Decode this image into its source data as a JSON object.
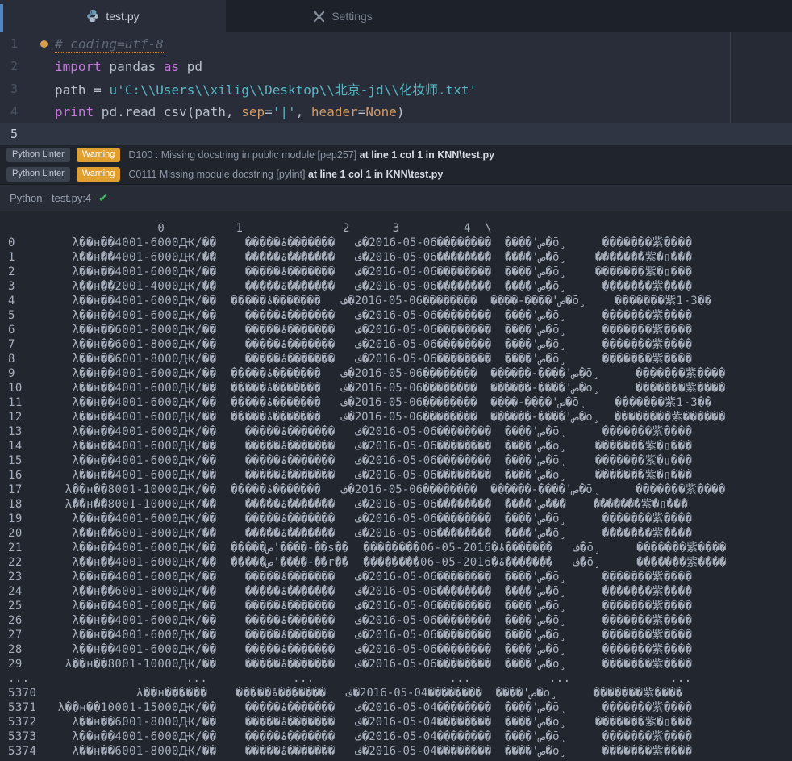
{
  "tabbar": {
    "tabs": [
      {
        "label": "test.py",
        "icon": "python"
      },
      {
        "label": "Settings",
        "icon": "tools"
      }
    ]
  },
  "editor": {
    "lines": [
      {
        "num": "1",
        "dot": true,
        "tokens": [
          {
            "cls": "comment ul",
            "t": "# coding=utf-8"
          }
        ]
      },
      {
        "num": "2",
        "tokens": [
          {
            "cls": "kw",
            "t": "import"
          },
          {
            "cls": "fg",
            "t": " pandas "
          },
          {
            "cls": "kw",
            "t": "as"
          },
          {
            "cls": "fg",
            "t": " pd"
          }
        ]
      },
      {
        "num": "3",
        "tokens": [
          {
            "cls": "fg",
            "t": "path = "
          },
          {
            "cls": "str",
            "t": "u'C:\\\\Users\\\\xilig\\\\Desktop\\\\北京-jd\\\\化妆师.txt'"
          }
        ]
      },
      {
        "num": "4",
        "tokens": [
          {
            "cls": "kw",
            "t": "print"
          },
          {
            "cls": "fg",
            "t": " pd.read_csv(path, "
          },
          {
            "cls": "orange",
            "t": "sep"
          },
          {
            "cls": "fg",
            "t": "="
          },
          {
            "cls": "str",
            "t": "'|'"
          },
          {
            "cls": "fg",
            "t": ", "
          },
          {
            "cls": "orange",
            "t": "header"
          },
          {
            "cls": "fg",
            "t": "="
          },
          {
            "cls": "orange",
            "t": "None"
          },
          {
            "cls": "fg",
            "t": ")"
          }
        ]
      },
      {
        "num": "5",
        "current": true,
        "tokens": []
      }
    ]
  },
  "lint": {
    "warnings": [
      {
        "source": "Python Linter",
        "level": "Warning",
        "message": "D100 : Missing docstring in public module [pep257] ",
        "location": "at line 1 col 1 in KNN\\test.py"
      },
      {
        "source": "Python Linter",
        "level": "Warning",
        "message": "C0111 Missing module docstring [pylint] ",
        "location": "at line 1 col 1 in KNN\\test.py"
      }
    ]
  },
  "status": {
    "label": "Python - test.py:4",
    "check": "✔"
  },
  "output": {
    "header_line": "                     0          1              2      3         4  \\",
    "col_widths": {
      "i": 5,
      "c0": 23,
      "c1": 13,
      "c2": 20,
      "c3": 12,
      "c4": 15
    },
    "rows": [
      {
        "i": "0",
        "c0": "λ��н��4001-6000Ԫ/��",
        "c1": "�����ص'����",
        "c2": "��������06-05-2016�ف",
        "c3": "�������ۂ�ō¸",
        "c4": "�������紫����"
      },
      {
        "i": "1",
        "c0": "λ��н��4001-6000Ԫ/��",
        "c1": "�����ص'����",
        "c2": "��������06-05-2016�ف",
        "c3": "�������ۂ�ō¸",
        "c4": "�������紫�▯���"
      },
      {
        "i": "2",
        "c0": "λ��н��4001-6000Ԫ/��",
        "c1": "�����ص'����",
        "c2": "��������06-05-2016�ف",
        "c3": "�������ۂ�ō¸",
        "c4": "�������紫�▯���"
      },
      {
        "i": "3",
        "c0": "λ��н��2001-4000Ԫ/��",
        "c1": "�����ص'����",
        "c2": "��������06-05-2016�ف",
        "c3": "�������ۂ�ō¸",
        "c4": "�������紫����"
      },
      {
        "i": "4",
        "c0": "λ��н��4001-6000Ԫ/��",
        "c1": "�����ص'����-����",
        "c2": "��������06-05-2016�ف",
        "c3": "�������ۂ�ō¸",
        "c4": "�������紫1-3��"
      },
      {
        "i": "5",
        "c0": "λ��н��4001-6000Ԫ/��",
        "c1": "�����ص'����",
        "c2": "��������06-05-2016�ف",
        "c3": "�������ۂ�ō¸",
        "c4": "�������紫����"
      },
      {
        "i": "6",
        "c0": "λ��н��6001-8000Ԫ/��",
        "c1": "�����ص'����",
        "c2": "��������06-05-2016�ف",
        "c3": "�������ۂ�ō¸",
        "c4": "�������紫����"
      },
      {
        "i": "7",
        "c0": "λ��н��6001-8000Ԫ/��",
        "c1": "�����ص'����",
        "c2": "��������06-05-2016�ف",
        "c3": "�������ۂ�ō¸",
        "c4": "�������紫����"
      },
      {
        "i": "8",
        "c0": "λ��н��6001-8000Ԫ/��",
        "c1": "�����ص'����",
        "c2": "��������06-05-2016�ف",
        "c3": "�������ۂ�ō¸",
        "c4": "�������紫����"
      },
      {
        "i": "9",
        "c0": "λ��н��4001-6000Ԫ/��",
        "c1": "�����ص'����-������",
        "c2": "��������06-05-2016�ف",
        "c3": "�������ۂ�ō¸",
        "c4": "�������紫����"
      },
      {
        "i": "10",
        "c0": "λ��н��4001-6000Ԫ/��",
        "c1": "�����ص'����-������",
        "c2": "��������06-05-2016�ف",
        "c3": "�������ۂ�ō¸",
        "c4": "�������紫����"
      },
      {
        "i": "11",
        "c0": "λ��н��4001-6000Ԫ/��",
        "c1": "�����ص'����-����",
        "c2": "��������06-05-2016�ف",
        "c3": "�������ۂ�ō¸",
        "c4": "�������紫1-3��"
      },
      {
        "i": "12",
        "c0": "λ��н��4001-6000Ԫ/��",
        "c1": "�����ص'����-������",
        "c2": "��������06-05-2016�ف",
        "c3": "�������ۂ�ō¸",
        "c4": "��������紫������"
      },
      {
        "i": "13",
        "c0": "λ��н��4001-6000Ԫ/��",
        "c1": "�����ص'����",
        "c2": "��������06-05-2016�ف",
        "c3": "�������ۂ�ō¸",
        "c4": "�������紫����"
      },
      {
        "i": "14",
        "c0": "λ��н��4001-6000Ԫ/��",
        "c1": "�����ص'����",
        "c2": "��������06-05-2016�ف",
        "c3": "�������ۂ�ō¸",
        "c4": "�������紫�▯���"
      },
      {
        "i": "15",
        "c0": "λ��н��4001-6000Ԫ/��",
        "c1": "�����ص'����",
        "c2": "��������06-05-2016�ف",
        "c3": "�������ۂ�ō¸",
        "c4": "�������紫�▯���"
      },
      {
        "i": "16",
        "c0": "λ��н��4001-6000Ԫ/��",
        "c1": "�����ص'����",
        "c2": "��������06-05-2016�ف",
        "c3": "�������ۂ�ō¸",
        "c4": "�������紫�▯���"
      },
      {
        "i": "17",
        "c0": "λ��н��8001-10000Ԫ/��",
        "c1": "�����ص'����-������",
        "c2": "��������06-05-2016�ف",
        "c3": "�������ۂ�ō¸",
        "c4": "�������紫����"
      },
      {
        "i": "18",
        "c0": "λ��н��8001-10000Ԫ/��",
        "c1": "�����ص'����",
        "c2": "��������06-05-2016�ف",
        "c3": "�������ۂ���",
        "c4": "�������紫�▯���"
      },
      {
        "i": "19",
        "c0": "λ��н��4001-6000Ԫ/��",
        "c1": "�����ص'����",
        "c2": "��������06-05-2016�ف",
        "c3": "�������ۂ�ō¸",
        "c4": "�������紫����"
      },
      {
        "i": "20",
        "c0": "λ��н��6001-8000Ԫ/��",
        "c1": "�����ص'����",
        "c2": "��������06-05-2016�ف",
        "c3": "�������ۂ�ō¸",
        "c4": "�������紫����"
      },
      {
        "i": "21",
        "c0": "λ��н��4001-6000Ԫ/��",
        "c1": "�����ص'����-��s��",
        "c2": "��������06-05-2016�ف",
        "c3": "�������ۂ�ō¸",
        "c4": "�������紫����"
      },
      {
        "i": "22",
        "c0": "λ��н��4001-6000Ԫ/��",
        "c1": "�����ص'����-��r��",
        "c2": "��������06-05-2016�ف",
        "c3": "�������ۂ�ō¸",
        "c4": "�������紫����"
      },
      {
        "i": "23",
        "c0": "λ��н��4001-6000Ԫ/��",
        "c1": "�����ص'����",
        "c2": "��������06-05-2016�ف",
        "c3": "�������ۂ�ō¸",
        "c4": "�������紫����"
      },
      {
        "i": "24",
        "c0": "λ��н��6001-8000Ԫ/��",
        "c1": "�����ص'����",
        "c2": "��������06-05-2016�ف",
        "c3": "�������ۂ�ō¸",
        "c4": "�������紫����"
      },
      {
        "i": "25",
        "c0": "λ��н��4001-6000Ԫ/��",
        "c1": "�����ص'����",
        "c2": "��������06-05-2016�ف",
        "c3": "�������ۂ�ō¸",
        "c4": "�������紫����"
      },
      {
        "i": "26",
        "c0": "λ��н��4001-6000Ԫ/��",
        "c1": "�����ص'����",
        "c2": "��������06-05-2016�ف",
        "c3": "�������ۂ�ō¸",
        "c4": "�������紫����"
      },
      {
        "i": "27",
        "c0": "λ��н��4001-6000Ԫ/��",
        "c1": "�����ص'����",
        "c2": "��������06-05-2016�ف",
        "c3": "�������ۂ�ō¸",
        "c4": "�������紫����"
      },
      {
        "i": "28",
        "c0": "λ��н��4001-6000Ԫ/��",
        "c1": "�����ص'����",
        "c2": "��������06-05-2016�ف",
        "c3": "�������ۂ�ō¸",
        "c4": "�������紫����"
      },
      {
        "i": "29",
        "c0": "λ��н��8001-10000Ԫ/��",
        "c1": "�����ص'����",
        "c2": "��������06-05-2016�ف",
        "c3": "�������ۂ�ō¸",
        "c4": "�������紫����"
      },
      {
        "i": "...",
        "c0": "...",
        "c1": "...",
        "c2": "...",
        "c3": "...",
        "c4": "..."
      },
      {
        "i": "5370",
        "c0": "λ��н������",
        "c1": "�����ص'����",
        "c2": "��������04-05-2016�ف",
        "c3": "�������ۂ�ō¸",
        "c4": "�������紫����"
      },
      {
        "i": "5371",
        "c0": "λ��н��10001-15000Ԫ/��",
        "c1": "�����ص'����",
        "c2": "��������04-05-2016�ف",
        "c3": "�������ۂ�ō¸",
        "c4": "�������紫����"
      },
      {
        "i": "5372",
        "c0": "λ��н��6001-8000Ԫ/��",
        "c1": "�����ص'����",
        "c2": "��������04-05-2016�ف",
        "c3": "�������ۂ�ō¸",
        "c4": "�������紫�▯���"
      },
      {
        "i": "5373",
        "c0": "λ��н��4001-6000Ԫ/��",
        "c1": "�����ص'����",
        "c2": "��������04-05-2016�ف",
        "c3": "�������ۂ�ō¸",
        "c4": "�������紫����"
      },
      {
        "i": "5374",
        "c0": "λ��н��6001-8000Ԫ/��",
        "c1": "�����ص'����",
        "c2": "��������04-05-2016�ف",
        "c3": "�������ۂ�ō¸",
        "c4": "�������紫����"
      }
    ]
  },
  "colors": {
    "accent_blue": "#4e86c6",
    "warning_badge": "#dfa02f",
    "success_check": "#3dbb61",
    "keyword": "#c678dd",
    "string": "#56b6c2",
    "builtin_orange": "#d19a66",
    "comment": "#5f6775",
    "editor_bg": "#282d39",
    "output_bg": "#21262f"
  }
}
